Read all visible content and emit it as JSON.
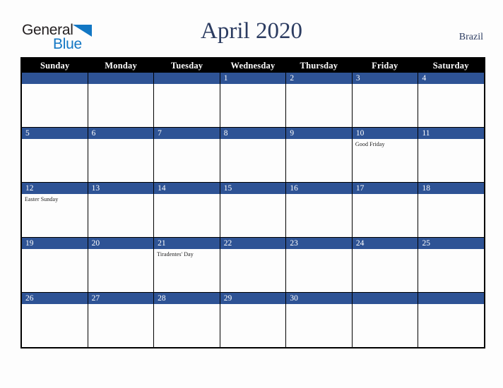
{
  "brand": {
    "name_part1": "General",
    "name_part2": "Blue",
    "triangle_icon": "triangle-icon"
  },
  "header": {
    "title": "April 2020",
    "country": "Brazil"
  },
  "colors": {
    "day_band_blue": "#2e5395",
    "weekday_header_black": "#000000",
    "title_navy": "#2c3c61",
    "logo_blue": "#1277c4",
    "page_background": "#fdfdfd"
  },
  "calendar": {
    "weekdays": [
      "Sunday",
      "Monday",
      "Tuesday",
      "Wednesday",
      "Thursday",
      "Friday",
      "Saturday"
    ],
    "weeks": [
      [
        {
          "day": "",
          "event": ""
        },
        {
          "day": "",
          "event": ""
        },
        {
          "day": "",
          "event": ""
        },
        {
          "day": "1",
          "event": ""
        },
        {
          "day": "2",
          "event": ""
        },
        {
          "day": "3",
          "event": ""
        },
        {
          "day": "4",
          "event": ""
        }
      ],
      [
        {
          "day": "5",
          "event": ""
        },
        {
          "day": "6",
          "event": ""
        },
        {
          "day": "7",
          "event": ""
        },
        {
          "day": "8",
          "event": ""
        },
        {
          "day": "9",
          "event": ""
        },
        {
          "day": "10",
          "event": "Good Friday"
        },
        {
          "day": "11",
          "event": ""
        }
      ],
      [
        {
          "day": "12",
          "event": "Easter Sunday"
        },
        {
          "day": "13",
          "event": ""
        },
        {
          "day": "14",
          "event": ""
        },
        {
          "day": "15",
          "event": ""
        },
        {
          "day": "16",
          "event": ""
        },
        {
          "day": "17",
          "event": ""
        },
        {
          "day": "18",
          "event": ""
        }
      ],
      [
        {
          "day": "19",
          "event": ""
        },
        {
          "day": "20",
          "event": ""
        },
        {
          "day": "21",
          "event": "Tiradentes' Day"
        },
        {
          "day": "22",
          "event": ""
        },
        {
          "day": "23",
          "event": ""
        },
        {
          "day": "24",
          "event": ""
        },
        {
          "day": "25",
          "event": ""
        }
      ],
      [
        {
          "day": "26",
          "event": ""
        },
        {
          "day": "27",
          "event": ""
        },
        {
          "day": "28",
          "event": ""
        },
        {
          "day": "29",
          "event": ""
        },
        {
          "day": "30",
          "event": ""
        },
        {
          "day": "",
          "event": ""
        },
        {
          "day": "",
          "event": ""
        }
      ]
    ]
  }
}
